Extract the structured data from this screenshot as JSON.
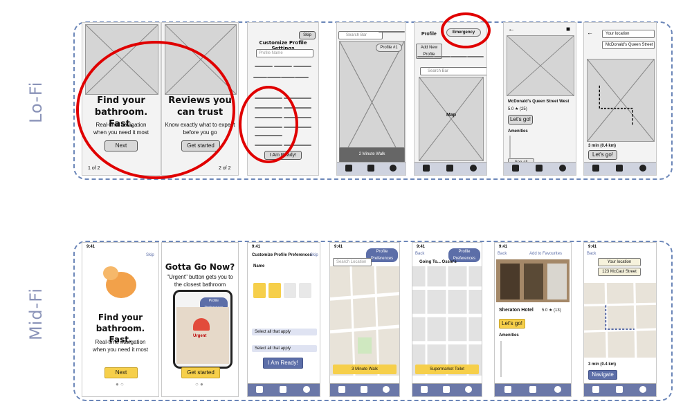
{
  "labels": {
    "lofi": "Lo-Fi",
    "midfi": "Mid-Fi"
  },
  "lofi": {
    "s1": {
      "title": "Find your bathroom. Fast.",
      "sub": "Real-time navigation when you need it most",
      "button": "Next",
      "page": "1 of 2"
    },
    "s2": {
      "title": "Reviews you can trust",
      "sub": "Know exactly what to expect before you go",
      "button": "Get started",
      "page": "2 of 2"
    },
    "s3": {
      "skip": "Skip",
      "title": "Customize Profile Settings",
      "field": "Profile Name",
      "button": "I Am Ready!"
    },
    "s4": {
      "search": "Search Bar",
      "profile": "Profile #1",
      "walk": "2 Minute Walk"
    },
    "s5": {
      "profile": "Profile",
      "emergency": "Emergency",
      "new_profile": "Add New Profile",
      "search": "Search Bar",
      "map_label": "Map"
    },
    "s6": {
      "place": "McDonald's Queen Street West",
      "rating": "5.0 ★ (25)",
      "cta": "Let's go!",
      "amenities": "Amenities",
      "see_all": "See all reviews"
    },
    "s7": {
      "from": "Your location",
      "to": "McDonald's Queen Street",
      "eta": "3 min (0.4 km)",
      "cta": "Let's go!"
    }
  },
  "midfi": {
    "s1": {
      "time": "9:41",
      "skip": "Skip",
      "title": "Find your bathroom. Fast.",
      "sub": "Real-time navigation when you need it most",
      "button": "Next"
    },
    "s2": {
      "time": "",
      "title": "Gotta Go Now?",
      "sub": "\"Urgent\" button gets you to the closest bathroom",
      "urgent": "Urgent",
      "pref": "Profile Preferences",
      "button": "Get started"
    },
    "s3": {
      "time": "9:41",
      "title": "Customize Profile Preferences",
      "skip": "Skip",
      "name": "Name",
      "select1": "Select all that apply",
      "select2": "Select all that apply",
      "button": "I Am Ready!"
    },
    "s4": {
      "time": "9:41",
      "pref": "Profile Preferences",
      "search": "Search Location",
      "walk": "3 Minute Walk"
    },
    "s5": {
      "time": "9:41",
      "back": "Back",
      "pref": "Profile Preferences",
      "title": "Going To... Ossie's",
      "toilet": "Supermarket Toilet"
    },
    "s6": {
      "time": "9:41",
      "back": "Back",
      "fav": "Add to Favourites",
      "place": "Sheraton Hotel",
      "rating": "5.0 ★ (13)",
      "cta": "Let's go!",
      "amenities": "Amenities"
    },
    "s7": {
      "time": "9:41",
      "back": "Back",
      "from": "Your location",
      "to": "123 McCaul Street",
      "eta": "3 min (0.4 km)",
      "cta": "Navigate"
    }
  },
  "colors": {
    "accent_yellow": "#f6cf4a",
    "accent_blue": "#5c6ea8",
    "annotation_red": "#e00000",
    "frame_blue": "#6b86b8"
  }
}
